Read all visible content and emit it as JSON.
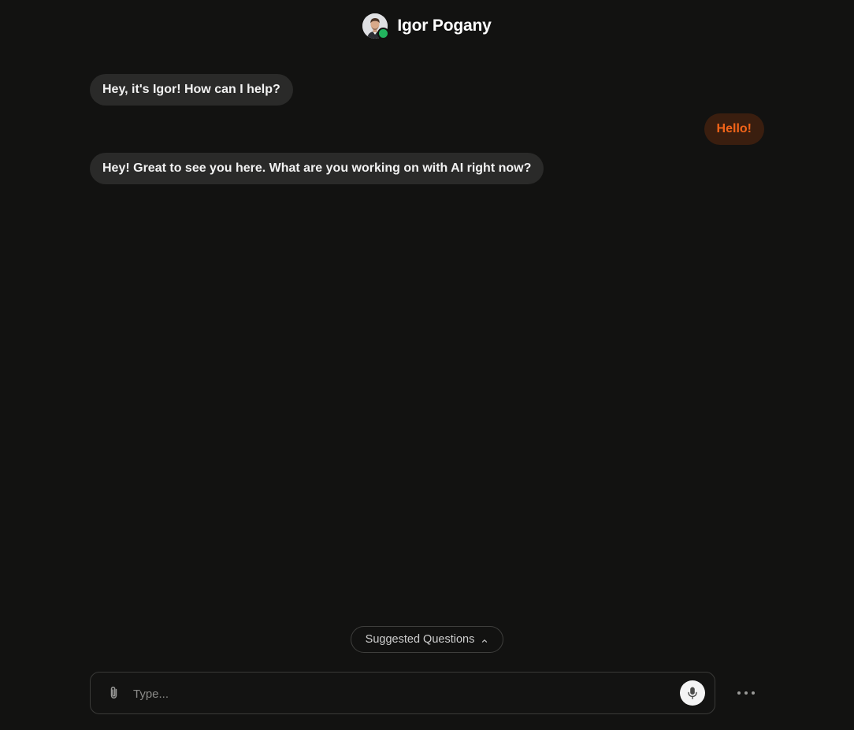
{
  "header": {
    "name": "Igor Pogany",
    "status": "online"
  },
  "messages": [
    {
      "role": "bot",
      "text": "Hey, it's Igor! How can I help?"
    },
    {
      "role": "user",
      "text": "Hello!"
    },
    {
      "role": "bot",
      "text": "Hey! Great to see you here. What are you working on with AI right now?"
    }
  ],
  "suggested": {
    "label": "Suggested Questions",
    "icon": "chevron-up-icon"
  },
  "composer": {
    "value": "",
    "placeholder": "Type...",
    "attach_icon": "paperclip-icon",
    "mic_icon": "microphone-icon",
    "more_icon": "more-dots-icon"
  },
  "colors": {
    "background": "#121211",
    "bot_bubble": "#2a2a29",
    "user_bubble": "#3a1e0f",
    "user_text": "#f26419",
    "online": "#22b35e"
  }
}
